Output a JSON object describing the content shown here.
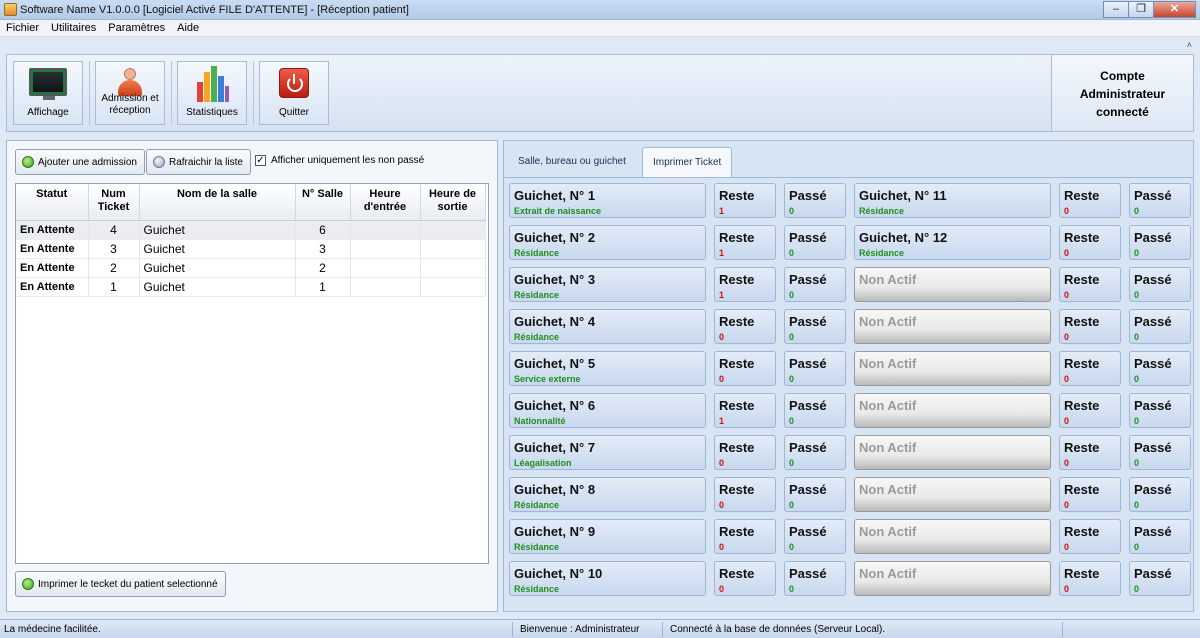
{
  "window": {
    "title": "Software Name V1.0.0.0 [Logiciel Activé FILE D'ATTENTE] - [Réception patient]",
    "close_glyph": "✕",
    "minimize_glyph": "–",
    "restore_glyph": "❐"
  },
  "menu": [
    "Fichier",
    "Utilitaires",
    "Paramètres",
    "Aide"
  ],
  "toolbar": {
    "buttons": [
      {
        "label": "Affichage",
        "icon": "monitor-icon"
      },
      {
        "label": "Admission et réception",
        "icon": "person-icon"
      },
      {
        "label": "Statistiques",
        "icon": "chart-icon"
      },
      {
        "label": "Quitter",
        "icon": "power-icon"
      }
    ],
    "account": "Compte Administrateur connecté",
    "collapse_glyph": "˄"
  },
  "left": {
    "add_label": "Ajouter une admission",
    "refresh_label": "Rafraichir la liste",
    "filter_label": "Afficher uniquement les non passé",
    "filter_checked": "✓",
    "print_label": "Imprimer le tecket du patient selectionné",
    "columns": [
      "Statut",
      "Num Ticket",
      "Nom de la salle",
      "N° Salle",
      "Heure d'entrée",
      "Heure de sortie"
    ],
    "rows": [
      {
        "statut": "En Attente",
        "num": "4",
        "salle": "Guichet",
        "no": "6",
        "in": "",
        "out": ""
      },
      {
        "statut": "En Attente",
        "num": "3",
        "salle": "Guichet",
        "no": "3",
        "in": "",
        "out": ""
      },
      {
        "statut": "En Attente",
        "num": "2",
        "salle": "Guichet",
        "no": "2",
        "in": "",
        "out": ""
      },
      {
        "statut": "En Attente",
        "num": "1",
        "salle": "Guichet",
        "no": "1",
        "in": "",
        "out": ""
      }
    ]
  },
  "right": {
    "tabs": [
      "Salle, bureau ou guichet",
      "Imprimer Ticket"
    ],
    "reste_label": "Reste",
    "passe_label": "Passé",
    "left_col": [
      {
        "name": "Guichet, N° 1",
        "service": "Extrait de naissance",
        "reste": "1",
        "passe": "0"
      },
      {
        "name": "Guichet, N° 2",
        "service": "Résidance",
        "reste": "1",
        "passe": "0"
      },
      {
        "name": "Guichet, N° 3",
        "service": "Résidance",
        "reste": "1",
        "passe": "0"
      },
      {
        "name": "Guichet, N° 4",
        "service": "Résidance",
        "reste": "0",
        "passe": "0"
      },
      {
        "name": "Guichet, N° 5",
        "service": "Service externe",
        "reste": "0",
        "passe": "0"
      },
      {
        "name": "Guichet, N° 6",
        "service": "Nationnalité",
        "reste": "1",
        "passe": "0"
      },
      {
        "name": "Guichet, N° 7",
        "service": "Léagalisation",
        "reste": "0",
        "passe": "0"
      },
      {
        "name": "Guichet, N° 8",
        "service": "Résidance",
        "reste": "0",
        "passe": "0"
      },
      {
        "name": "Guichet, N° 9",
        "service": "Résidance",
        "reste": "0",
        "passe": "0"
      },
      {
        "name": "Guichet, N° 10",
        "service": "Résidance",
        "reste": "0",
        "passe": "0"
      }
    ],
    "right_col": [
      {
        "name": "Guichet, N° 11",
        "service": "Résidance",
        "reste": "0",
        "passe": "0",
        "active": true
      },
      {
        "name": "Guichet, N° 12",
        "service": "Résidance",
        "reste": "0",
        "passe": "0",
        "active": true
      },
      {
        "name": "Non Actif",
        "service": "",
        "reste": "0",
        "passe": "0",
        "active": false
      },
      {
        "name": "Non Actif",
        "service": "",
        "reste": "0",
        "passe": "0",
        "active": false
      },
      {
        "name": "Non Actif",
        "service": "",
        "reste": "0",
        "passe": "0",
        "active": false
      },
      {
        "name": "Non Actif",
        "service": "",
        "reste": "0",
        "passe": "0",
        "active": false
      },
      {
        "name": "Non Actif",
        "service": "",
        "reste": "0",
        "passe": "0",
        "active": false
      },
      {
        "name": "Non Actif",
        "service": "",
        "reste": "0",
        "passe": "0",
        "active": false
      },
      {
        "name": "Non Actif",
        "service": "",
        "reste": "0",
        "passe": "0",
        "active": false
      },
      {
        "name": "Non Actif",
        "service": "",
        "reste": "0",
        "passe": "0",
        "active": false
      }
    ]
  },
  "status": {
    "left": "La médecine facilitée.",
    "user": "Bienvenue : Administrateur",
    "db": "Connecté à la base de données (Serveur Local)."
  }
}
